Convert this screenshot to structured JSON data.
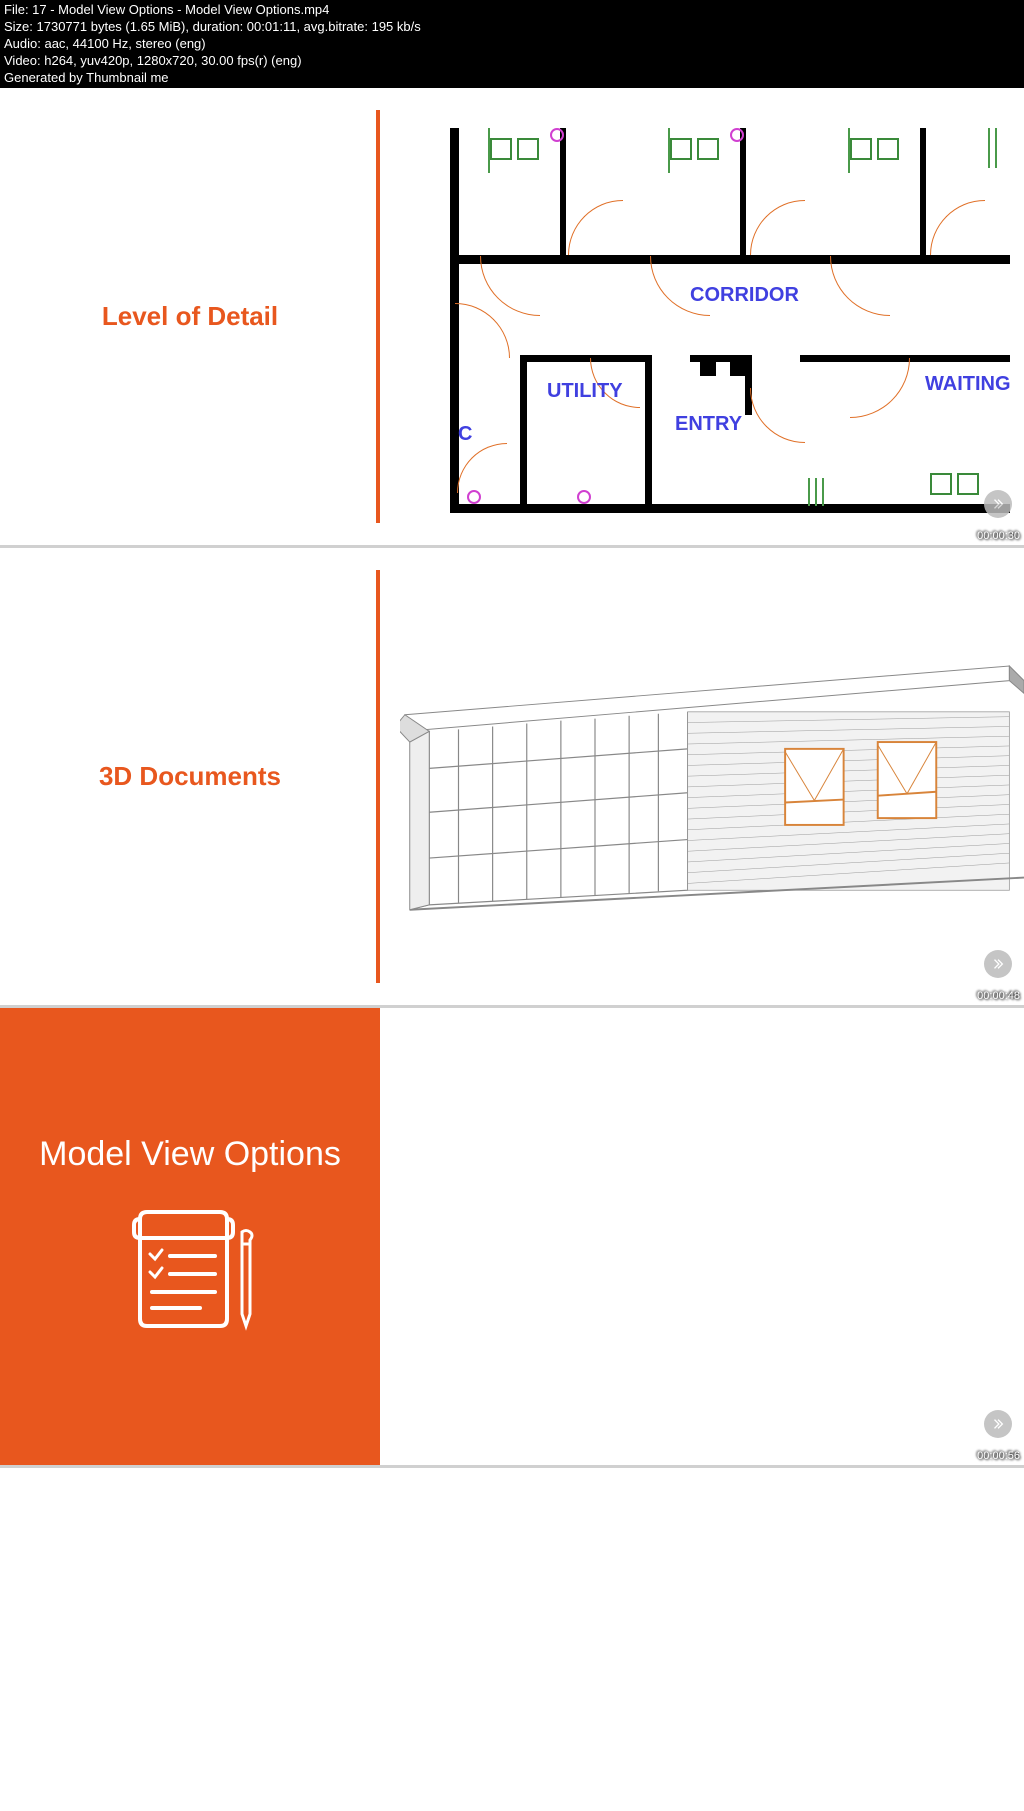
{
  "metadata": {
    "file": "File: 17 - Model View Options - Model View Options.mp4",
    "size": "Size: 1730771 bytes (1.65 MiB), duration: 00:01:11, avg.bitrate: 195 kb/s",
    "audio": "Audio: aac, 44100 Hz, stereo (eng)",
    "video": "Video: h264, yuv420p, 1280x720, 30.00 fps(r) (eng)",
    "generated": "Generated by Thumbnail me"
  },
  "thumbnails": [
    {
      "title": "Level of Detail",
      "timestamp": "00:00:30",
      "rooms": {
        "corridor": "CORRIDOR",
        "utility": "UTILITY",
        "entry": "ENTRY",
        "waiting": "WAITING",
        "c": "C"
      }
    },
    {
      "title": "3D Documents",
      "timestamp": "00:00:48"
    },
    {
      "title": "Model View Options",
      "timestamp": "00:00:56"
    }
  ]
}
